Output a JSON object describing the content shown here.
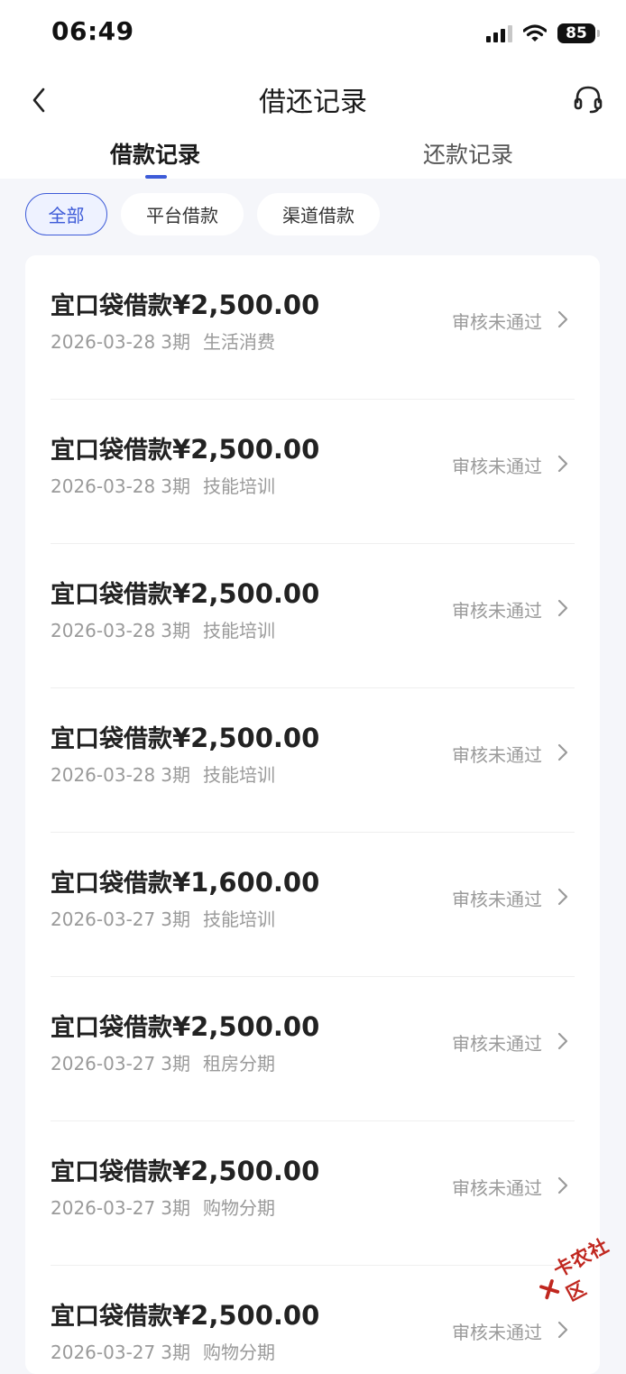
{
  "status_bar": {
    "time": "06:49",
    "battery": "85",
    "icons": [
      "cellular-signal-icon",
      "wifi-icon",
      "battery-icon"
    ]
  },
  "nav": {
    "title": "借还记录",
    "back_icon": "chevron-left-icon",
    "service_icon": "headset-icon"
  },
  "tabs": [
    {
      "label": "借款记录",
      "active": true
    },
    {
      "label": "还款记录",
      "active": false
    }
  ],
  "filters": [
    {
      "label": "全部",
      "selected": true
    },
    {
      "label": "平台借款",
      "selected": false
    },
    {
      "label": "渠道借款",
      "selected": false
    }
  ],
  "records": [
    {
      "name": "宜口袋借款",
      "amount": "¥2,500.00",
      "date": "2026-03-28",
      "period": "3期",
      "purpose": "生活消费",
      "status": "审核未通过"
    },
    {
      "name": "宜口袋借款",
      "amount": "¥2,500.00",
      "date": "2026-03-28",
      "period": "3期",
      "purpose": "技能培训",
      "status": "审核未通过"
    },
    {
      "name": "宜口袋借款",
      "amount": "¥2,500.00",
      "date": "2026-03-28",
      "period": "3期",
      "purpose": "技能培训",
      "status": "审核未通过"
    },
    {
      "name": "宜口袋借款",
      "amount": "¥2,500.00",
      "date": "2026-03-28",
      "period": "3期",
      "purpose": "技能培训",
      "status": "审核未通过"
    },
    {
      "name": "宜口袋借款",
      "amount": "¥1,600.00",
      "date": "2026-03-27",
      "period": "3期",
      "purpose": "技能培训",
      "status": "审核未通过"
    },
    {
      "name": "宜口袋借款",
      "amount": "¥2,500.00",
      "date": "2026-03-27",
      "period": "3期",
      "purpose": "租房分期",
      "status": "审核未通过"
    },
    {
      "name": "宜口袋借款",
      "amount": "¥2,500.00",
      "date": "2026-03-27",
      "period": "3期",
      "purpose": "购物分期",
      "status": "审核未通过"
    },
    {
      "name": "宜口袋借款",
      "amount": "¥2,500.00",
      "date": "2026-03-27",
      "period": "3期",
      "purpose": "购物分期",
      "status": "审核未通过"
    }
  ],
  "watermark": {
    "text": "卡农社区"
  },
  "colors": {
    "accent": "#3d5bd8",
    "background": "#f5f6fa",
    "muted_text": "#9a9a9a",
    "watermark": "#c0271f"
  }
}
